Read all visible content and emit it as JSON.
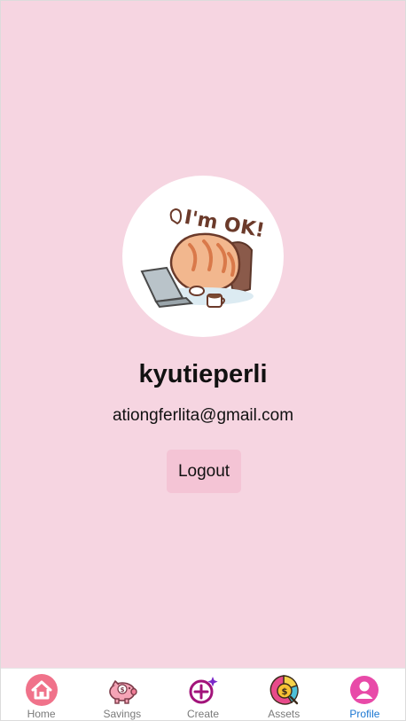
{
  "profile": {
    "username": "kyutieperli",
    "email": "ationgferlita@gmail.com",
    "avatar_icon": "cat-on-laptop-sticker",
    "avatar_sticker_text": "I'm OK!"
  },
  "actions": {
    "logout_label": "Logout"
  },
  "tabbar": {
    "active": "Profile",
    "items": [
      {
        "label": "Home",
        "icon": "home-icon"
      },
      {
        "label": "Savings",
        "icon": "piggy-bank-icon"
      },
      {
        "label": "Create",
        "icon": "create-plus-icon"
      },
      {
        "label": "Assets",
        "icon": "assets-chart-icon"
      },
      {
        "label": "Profile",
        "icon": "profile-icon"
      }
    ]
  },
  "colors": {
    "background": "#f6d5e1",
    "logout_button": "#f4c4d5",
    "active_tab": "#1976d2"
  }
}
